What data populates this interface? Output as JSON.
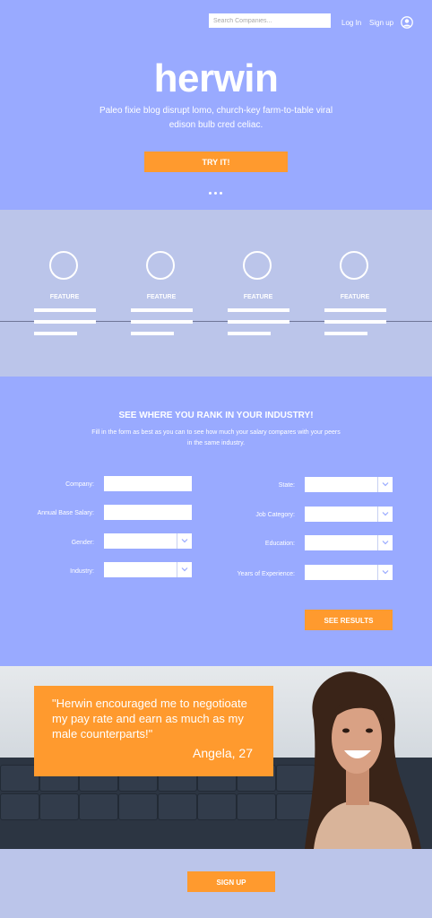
{
  "header": {
    "search_placeholder": "Search Companies...",
    "login_label": "Log In",
    "signup_label": "Sign up",
    "user_icon": "user-circle-icon"
  },
  "hero": {
    "logo": "herwin",
    "tagline": "Paleo fixie blog disrupt lomo, church-key farm-to-table viral edison bulb cred celiac.",
    "cta_label": "TRY IT!",
    "carousel_dots": 3
  },
  "features": {
    "items": [
      {
        "label": "FEATURE"
      },
      {
        "label": "FEATURE"
      },
      {
        "label": "FEATURE"
      },
      {
        "label": "FEATURE"
      }
    ]
  },
  "form": {
    "title": "SEE WHERE YOU RANK IN YOUR INDUSTRY!",
    "description": "Fill in the form as best as you can to see how much your salary compares with your peers in the same industry.",
    "fields": {
      "company": "Company:",
      "salary": "Annual Base Salary:",
      "gender": "Gender:",
      "industry": "Industry:",
      "state": "State:",
      "job_category": "Job Category:",
      "education": "Education:",
      "experience": "Years of Experience:"
    },
    "submit_label": "SEE RESULTS"
  },
  "testimonial": {
    "quote": "\"Herwin encouraged me to negotioate my pay rate and earn as much as my male counterparts!\"",
    "author": "Angela, 27"
  },
  "footer": {
    "signup_label": "SIGN UP"
  },
  "colors": {
    "hero_bg": "#99aaff",
    "section_bg": "#bbc5ea",
    "accent": "#ff9a2e",
    "text": "#ffffff"
  }
}
